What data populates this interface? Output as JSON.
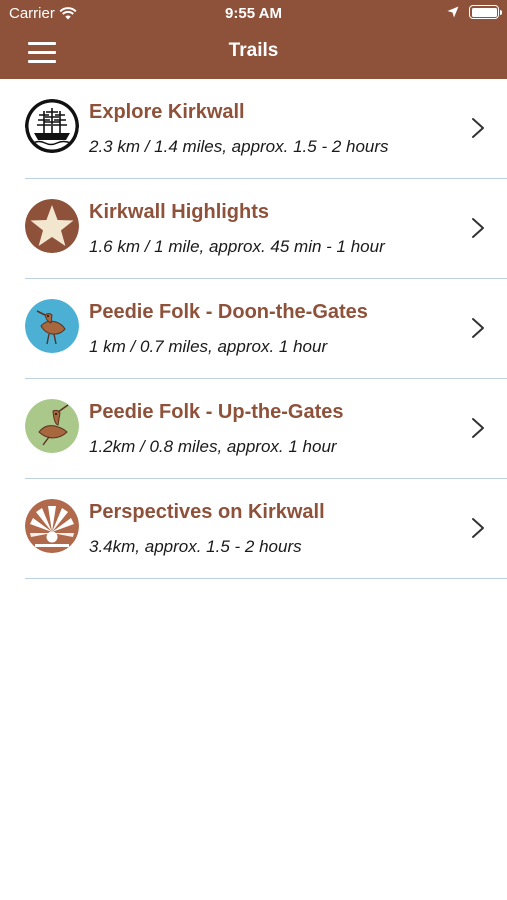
{
  "status_bar": {
    "carrier": "Carrier",
    "time": "9:55 AM"
  },
  "navbar": {
    "title": "Trails"
  },
  "colors": {
    "brand": "#8e513a",
    "separator": "#bcd1e1"
  },
  "trails": [
    {
      "title": "Explore Kirkwall",
      "subtitle": "2.3 km / 1.4 miles, approx. 1.5 - 2 hours",
      "icon": "ship-icon"
    },
    {
      "title": "Kirkwall Highlights",
      "subtitle": "1.6 km / 1 mile, approx. 45 min - 1 hour",
      "icon": "star-icon"
    },
    {
      "title": "Peedie Folk - Doon-the-Gates",
      "subtitle": "1 km / 0.7 miles, approx. 1 hour",
      "icon": "bird-blue-icon"
    },
    {
      "title": "Peedie Folk - Up-the-Gates",
      "subtitle": "1.2km / 0.8 miles, approx. 1 hour",
      "icon": "bird-green-icon"
    },
    {
      "title": "Perspectives on Kirkwall",
      "subtitle": "3.4km, approx. 1.5 - 2 hours",
      "icon": "shell-icon"
    }
  ]
}
